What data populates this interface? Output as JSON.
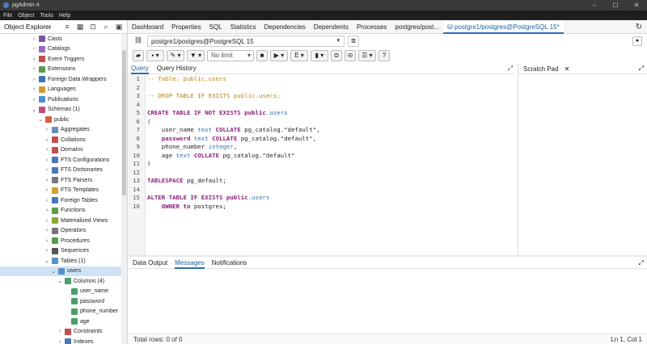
{
  "window": {
    "title": "pgAdmin 4",
    "controls": [
      "–",
      "☐",
      "✕"
    ]
  },
  "menu": [
    "File",
    "Object",
    "Tools",
    "Help"
  ],
  "explorer": {
    "title": "Object Explorer",
    "items": [
      {
        "label": "Casts",
        "depth": 3,
        "chevron": "›",
        "color": "#7b55a8"
      },
      {
        "label": "Catalogs",
        "depth": 3,
        "chevron": "›",
        "color": "#9c6bc8"
      },
      {
        "label": "Event Triggers",
        "depth": 3,
        "chevron": "›",
        "color": "#c54b4b"
      },
      {
        "label": "Extensions",
        "depth": 3,
        "chevron": "›",
        "color": "#5a9b4a"
      },
      {
        "label": "Foreign Data Wrappers",
        "depth": 3,
        "chevron": "›",
        "color": "#3f73b9"
      },
      {
        "label": "Languages",
        "depth": 3,
        "chevron": "›",
        "color": "#d49a2b"
      },
      {
        "label": "Publications",
        "depth": 3,
        "chevron": "›",
        "color": "#4c8fd4"
      },
      {
        "label": "Schemas (1)",
        "depth": 3,
        "chevron": "⌄",
        "color": "#c44d7d"
      },
      {
        "label": "public",
        "depth": 4,
        "chevron": "⌄",
        "color": "#d85d3f"
      },
      {
        "label": "Aggregates",
        "depth": 5,
        "chevron": "›",
        "color": "#6a8fb8"
      },
      {
        "label": "Collations",
        "depth": 5,
        "chevron": "›",
        "color": "#c44d4d"
      },
      {
        "label": "Domains",
        "depth": 5,
        "chevron": "›",
        "color": "#c44d4d"
      },
      {
        "label": "FTS Configurations",
        "depth": 5,
        "chevron": "›",
        "color": "#4a78b8"
      },
      {
        "label": "FTS Dictionaries",
        "depth": 5,
        "chevron": "›",
        "color": "#4a78b8"
      },
      {
        "label": "FTS Parsers",
        "depth": 5,
        "chevron": "›",
        "color": "#777777"
      },
      {
        "label": "FTS Templates",
        "depth": 5,
        "chevron": "›",
        "color": "#d4a02b"
      },
      {
        "label": "Foreign Tables",
        "depth": 5,
        "chevron": "›",
        "color": "#4a78b8"
      },
      {
        "label": "Functions",
        "depth": 5,
        "chevron": "›",
        "color": "#5a9b4a"
      },
      {
        "label": "Materialized Views",
        "depth": 5,
        "chevron": "›",
        "color": "#8aa832"
      },
      {
        "label": "Operators",
        "depth": 5,
        "chevron": "›",
        "color": "#777777"
      },
      {
        "label": "Procedures",
        "depth": 5,
        "chevron": "›",
        "color": "#5a9b4a"
      },
      {
        "label": "Sequences",
        "depth": 5,
        "chevron": "›",
        "color": "#555555"
      },
      {
        "label": "Tables (1)",
        "depth": 5,
        "chevron": "⌄",
        "color": "#5a8fc8"
      },
      {
        "label": "users",
        "depth": 6,
        "chevron": "⌄",
        "color": "#5a8fc8",
        "selected": true
      },
      {
        "label": "Columns (4)",
        "depth": 7,
        "chevron": "⌄",
        "color": "#4aa06a"
      },
      {
        "label": "user_name",
        "depth": 8,
        "chevron": "",
        "color": "#4aa06a"
      },
      {
        "label": "password",
        "depth": 8,
        "chevron": "",
        "color": "#4aa06a"
      },
      {
        "label": "phone_number",
        "depth": 8,
        "chevron": "",
        "color": "#4aa06a"
      },
      {
        "label": "age",
        "depth": 8,
        "chevron": "",
        "color": "#4aa06a"
      },
      {
        "label": "Constraints",
        "depth": 7,
        "chevron": "›",
        "color": "#c44d4d"
      },
      {
        "label": "Indexes",
        "depth": 7,
        "chevron": "›",
        "color": "#4a78b8"
      }
    ]
  },
  "tabs": [
    {
      "label": "Dashboard"
    },
    {
      "label": "Properties"
    },
    {
      "label": "SQL"
    },
    {
      "label": "Statistics"
    },
    {
      "label": "Dependencies"
    },
    {
      "label": "Dependents"
    },
    {
      "label": "Processes"
    },
    {
      "label": "postgres/post..."
    },
    {
      "label": "postgre1/postgres@PostgreSQL 15*",
      "active": true
    }
  ],
  "connection": {
    "value": "postgre1/postgres@PostgreSQL 15"
  },
  "toolbar": {
    "limit": "No limit"
  },
  "query_tabs": [
    "Query",
    "Query History"
  ],
  "scratch": {
    "title": "Scratch Pad"
  },
  "editor": {
    "lines": [
      [
        {
          "t": "-- Table: public.users",
          "c": "cmt"
        }
      ],
      [],
      [
        {
          "t": "-- DROP TABLE IF EXISTS public.users;",
          "c": "cmt"
        }
      ],
      [],
      [
        {
          "t": "CREATE TABLE IF NOT EXISTS ",
          "c": "kw"
        },
        {
          "t": "public",
          "c": "kw"
        },
        {
          "t": ".users",
          "c": "ty"
        }
      ],
      [
        {
          "t": "(",
          "c": ""
        }
      ],
      [
        {
          "t": "    user_name ",
          "c": ""
        },
        {
          "t": "text",
          "c": "ty"
        },
        {
          "t": " COLLATE ",
          "c": "kw"
        },
        {
          "t": "pg_catalog.\"default\",",
          "c": ""
        }
      ],
      [
        {
          "t": "    password ",
          "c": "kw"
        },
        {
          "t": "text",
          "c": "ty"
        },
        {
          "t": " COLLATE ",
          "c": "kw"
        },
        {
          "t": "pg_catalog.\"default\",",
          "c": ""
        }
      ],
      [
        {
          "t": "    phone_number ",
          "c": ""
        },
        {
          "t": "integer",
          "c": "ty"
        },
        {
          "t": ",",
          "c": ""
        }
      ],
      [
        {
          "t": "    age ",
          "c": ""
        },
        {
          "t": "text",
          "c": "ty"
        },
        {
          "t": " COLLATE ",
          "c": "kw"
        },
        {
          "t": "pg_catalog.\"default\"",
          "c": ""
        }
      ],
      [
        {
          "t": ")",
          "c": ""
        }
      ],
      [],
      [
        {
          "t": "TABLESPACE ",
          "c": "kw"
        },
        {
          "t": "pg_default;",
          "c": ""
        }
      ],
      [],
      [
        {
          "t": "ALTER TABLE IF EXISTS ",
          "c": "kw"
        },
        {
          "t": "public",
          "c": "kw"
        },
        {
          "t": ".users",
          "c": "ty"
        }
      ],
      [
        {
          "t": "    OWNER ",
          "c": "kw"
        },
        {
          "t": "to",
          "c": "kw"
        },
        {
          "t": " postgres;",
          "c": ""
        }
      ]
    ]
  },
  "output_tabs": [
    "Data Output",
    "Messages",
    "Notifications"
  ],
  "status": {
    "left": "Total rows: 0 of 0",
    "right": "Ln 1, Col 1"
  }
}
